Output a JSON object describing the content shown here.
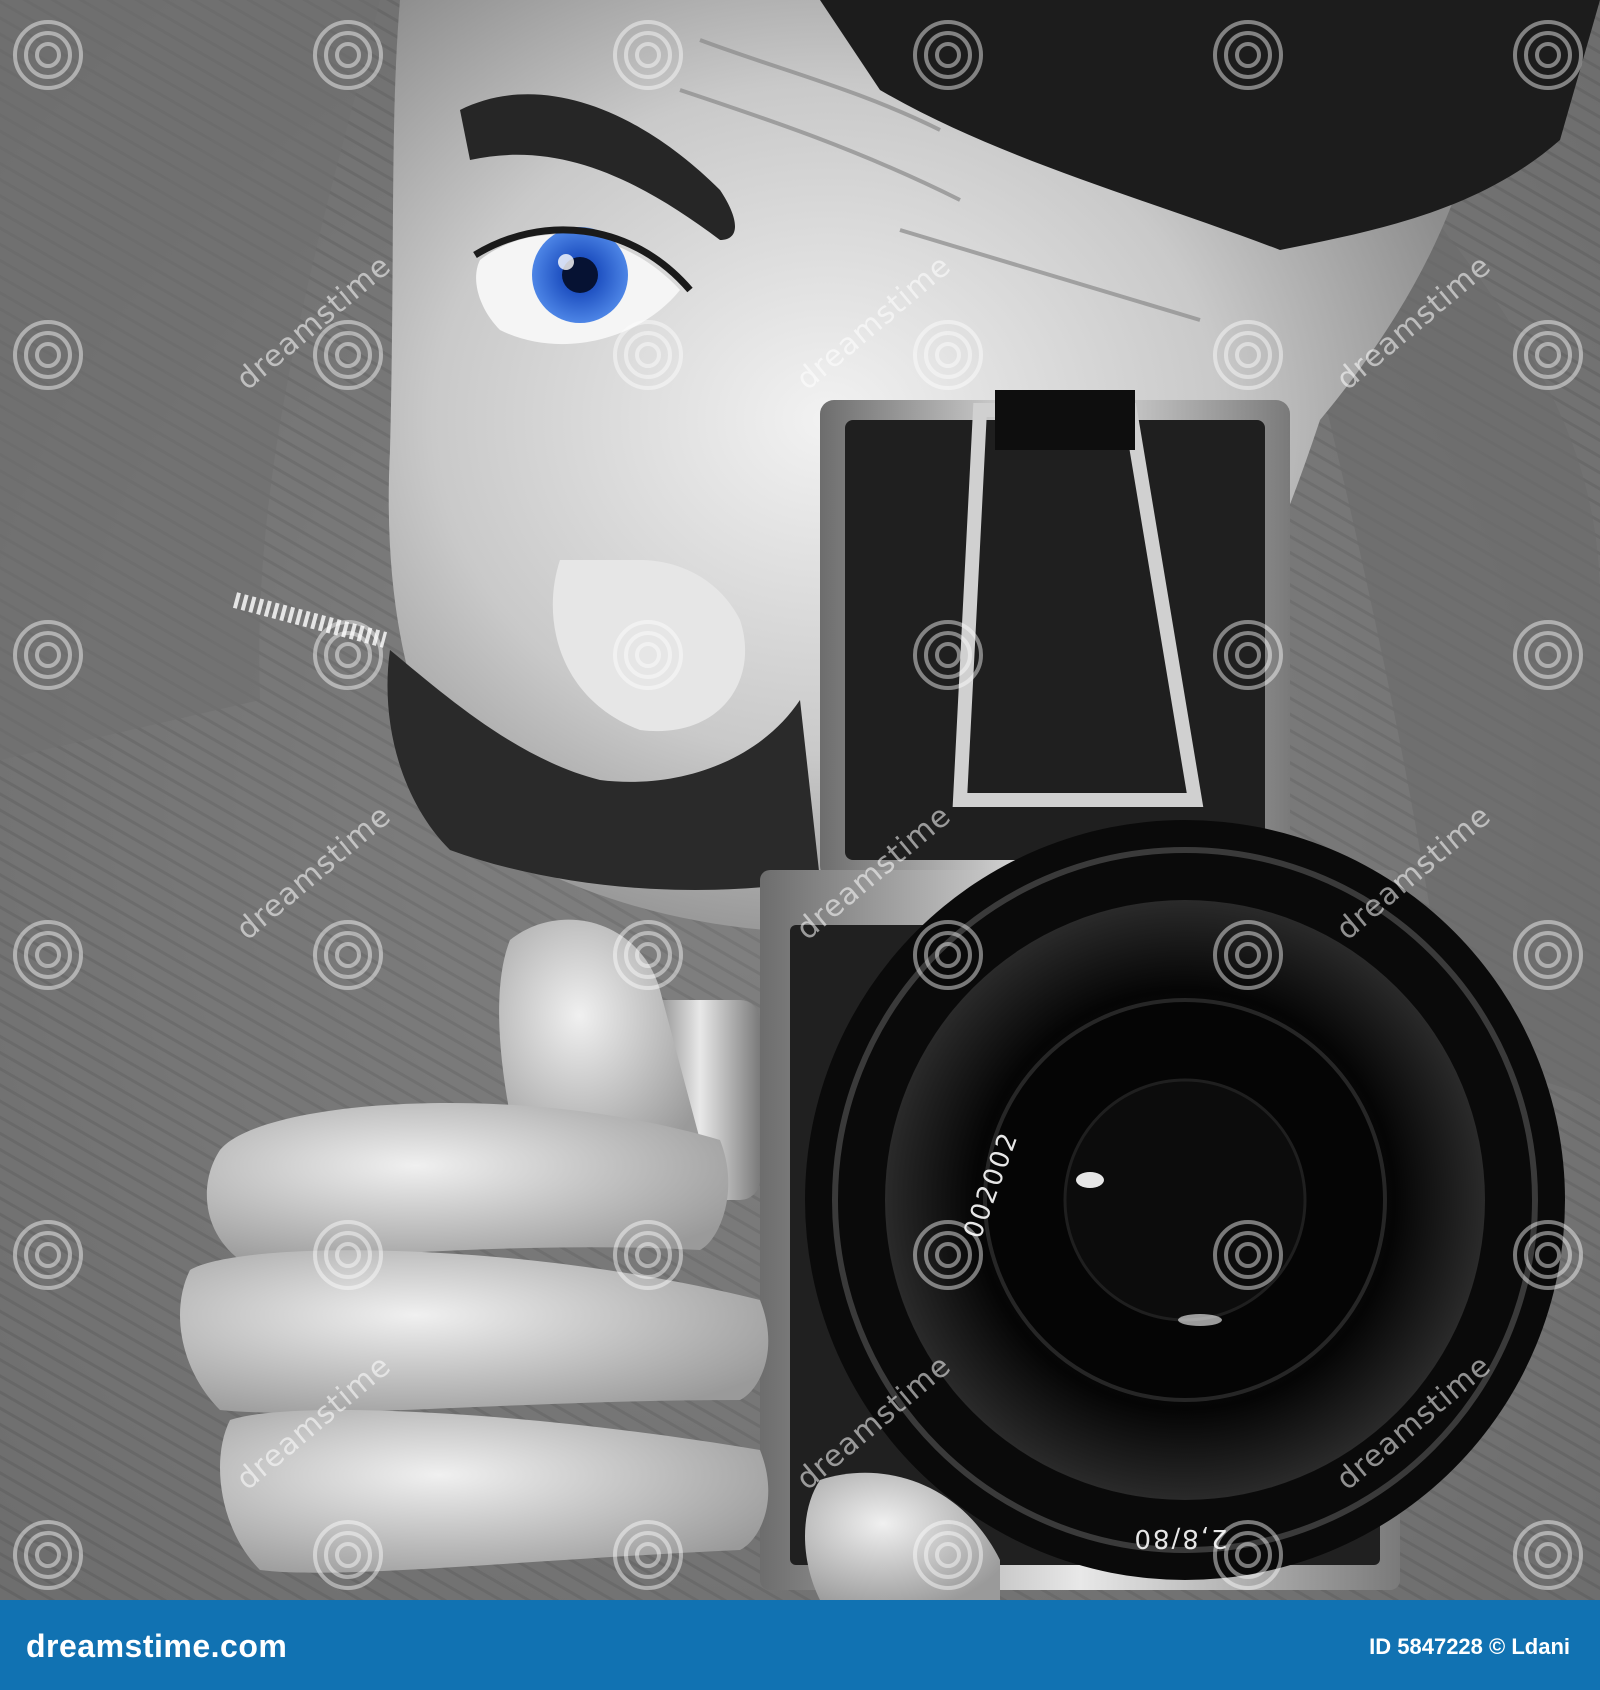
{
  "photo": {
    "subject_icon": "photographer-with-medium-format-camera",
    "eye_color": "#2a5fd4",
    "lens_serial": "002002",
    "lens_spec": "2,8/80"
  },
  "watermark": {
    "text": "dreamstime",
    "icon": "spiral-logo-icon"
  },
  "footer": {
    "brand": "dreamstime.com",
    "credit": "ID 5847228 © Ldani",
    "background_color": "#1172b2"
  }
}
